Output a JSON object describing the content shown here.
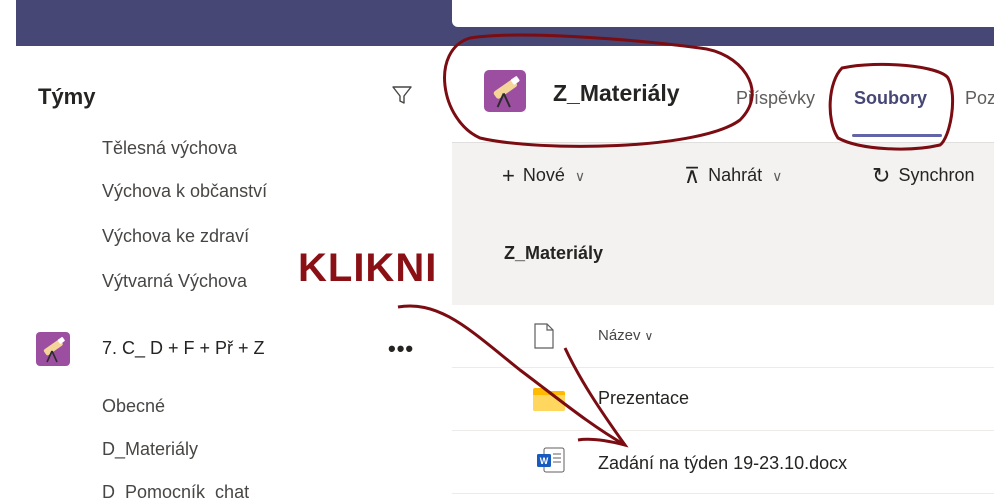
{
  "left": {
    "title": "Týmy",
    "channels_top": [
      "Tělesná výchova",
      "Výchova k občanství",
      "Výchova ke zdraví",
      "Výtvarná Výchova"
    ],
    "team": {
      "name": "7. C_ D + F + Př + Z",
      "more": "•••"
    },
    "channels_bottom": [
      "Obecné",
      "D_Materiály",
      "D_Pomocník_chat"
    ],
    "filter_icon": "filter-icon"
  },
  "annotation": {
    "text": "KLIKNI",
    "color": "#8b1015"
  },
  "header": {
    "channel_title": "Z_Materiály",
    "tabs": [
      {
        "label": "Příspěvky",
        "active": false
      },
      {
        "label": "Soubory",
        "active": true
      },
      {
        "label": "Poz",
        "active": false
      }
    ]
  },
  "toolbar": {
    "new_label": "Nové",
    "upload_label": "Nahrát",
    "sync_label": "Synchron"
  },
  "files": {
    "folder_title": "Z_Materiály",
    "column_name": "Název",
    "rows": [
      {
        "name": "Prezentace",
        "type": "folder-icon"
      },
      {
        "name": "Zadání na týden 19-23.10.docx",
        "type": "word-icon"
      }
    ]
  },
  "colors": {
    "brand": "#464775",
    "accent": "#6264a7",
    "avatar": "#9c4fa0",
    "folder": "#ffb900",
    "word": "#185abd"
  }
}
